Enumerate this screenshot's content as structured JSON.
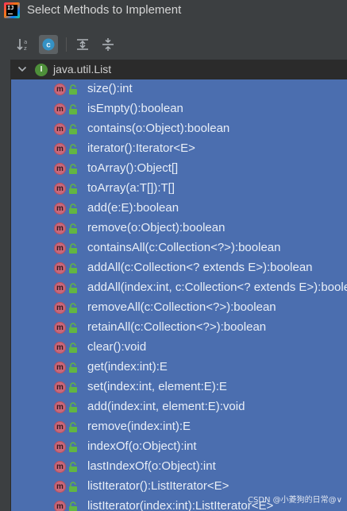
{
  "window": {
    "title": "Select Methods to Implement",
    "app_icon_text": "IJ"
  },
  "toolbar": {
    "buttons": [
      {
        "name": "sort-alphabetically-button",
        "icon": "sort-az-icon",
        "active": false
      },
      {
        "name": "show-classes-button",
        "icon": "class-c-icon",
        "active": true
      },
      {
        "name": "expand-all-button",
        "icon": "expand-all-icon",
        "active": false
      },
      {
        "name": "collapse-all-button",
        "icon": "collapse-all-icon",
        "active": false
      }
    ]
  },
  "tree": {
    "root": {
      "icon_letter": "I",
      "label": "java.util.List",
      "expanded": true
    },
    "methods": [
      "size():int",
      "isEmpty():boolean",
      "contains(o:Object):boolean",
      "iterator():Iterator<E>",
      "toArray():Object[]",
      "toArray(a:T[]):T[]",
      "add(e:E):boolean",
      "remove(o:Object):boolean",
      "containsAll(c:Collection<?>):boolean",
      "addAll(c:Collection<? extends E>):boolean",
      "addAll(index:int, c:Collection<? extends E>):boolean",
      "removeAll(c:Collection<?>):boolean",
      "retainAll(c:Collection<?>):boolean",
      "clear():void",
      "get(index:int):E",
      "set(index:int, element:E):E",
      "add(index:int, element:E):void",
      "remove(index:int):E",
      "indexOf(o:Object):int",
      "lastIndexOf(o:Object):int",
      "listIterator():ListIterator<E>",
      "listIterator(index:int):ListIterator<E>"
    ],
    "method_icon_letter": "m"
  },
  "watermark": "CSDN @小菱狗的日常@∨",
  "colors": {
    "background": "#3c3f41",
    "selection": "#4b6eaf",
    "method_icon": "#c9687a",
    "interface_icon": "#4e8f3a",
    "lock": "#62b543"
  }
}
